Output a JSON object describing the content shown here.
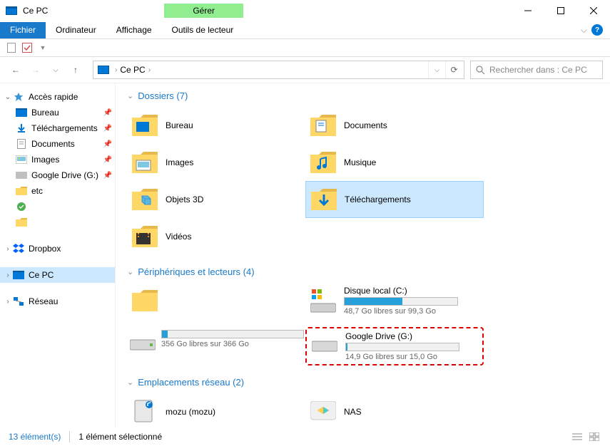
{
  "title": "Ce PC",
  "manage_label": "Gérer",
  "ribbon": {
    "file": "Fichier",
    "ordinateur": "Ordinateur",
    "affichage": "Affichage",
    "outils": "Outils de lecteur"
  },
  "address": {
    "path": "Ce PC",
    "search_placeholder": "Rechercher dans : Ce PC"
  },
  "sidebar": {
    "quick_access": "Accès rapide",
    "items": [
      {
        "label": "Bureau",
        "pinned": true,
        "icon": "desktop"
      },
      {
        "label": "Téléchargements",
        "pinned": true,
        "icon": "download"
      },
      {
        "label": "Documents",
        "pinned": true,
        "icon": "documents"
      },
      {
        "label": "Images",
        "pinned": true,
        "icon": "images"
      },
      {
        "label": "Google Drive (G:)",
        "pinned": true,
        "icon": "drive"
      },
      {
        "label": "etc",
        "pinned": false,
        "icon": "folder"
      }
    ],
    "dropbox": "Dropbox",
    "cepc": "Ce PC",
    "reseau": "Réseau"
  },
  "sections": {
    "dossiers_title": "Dossiers (7)",
    "folders": [
      {
        "label": "Bureau"
      },
      {
        "label": "Documents"
      },
      {
        "label": "Images"
      },
      {
        "label": "Musique"
      },
      {
        "label": "Objets 3D"
      },
      {
        "label": "Téléchargements",
        "selected": true
      },
      {
        "label": "Vidéos"
      }
    ],
    "drives_title": "Périphériques et lecteurs (4)",
    "drives": [
      {
        "name": "",
        "free_text": "356 Go libres sur 366 Go",
        "fill_pct": 4,
        "icon": "floppy"
      },
      {
        "name": "Disque local (C:)",
        "free_text": "48,7 Go libres sur 99,3 Go",
        "fill_pct": 51,
        "icon": "windrive"
      },
      {
        "name": "",
        "free_text": "",
        "fill_pct": 0,
        "icon": "hidden"
      },
      {
        "name": "Google Drive (G:)",
        "free_text": "14,9 Go libres sur 15,0 Go",
        "fill_pct": 1,
        "icon": "drive",
        "highlight": true
      }
    ],
    "network_title": "Emplacements réseau (2)",
    "network": [
      {
        "label": "mozu (mozu)"
      },
      {
        "label": "NAS"
      }
    ]
  },
  "status": {
    "count": "13 élément(s)",
    "selected": "1 élément sélectionné"
  }
}
